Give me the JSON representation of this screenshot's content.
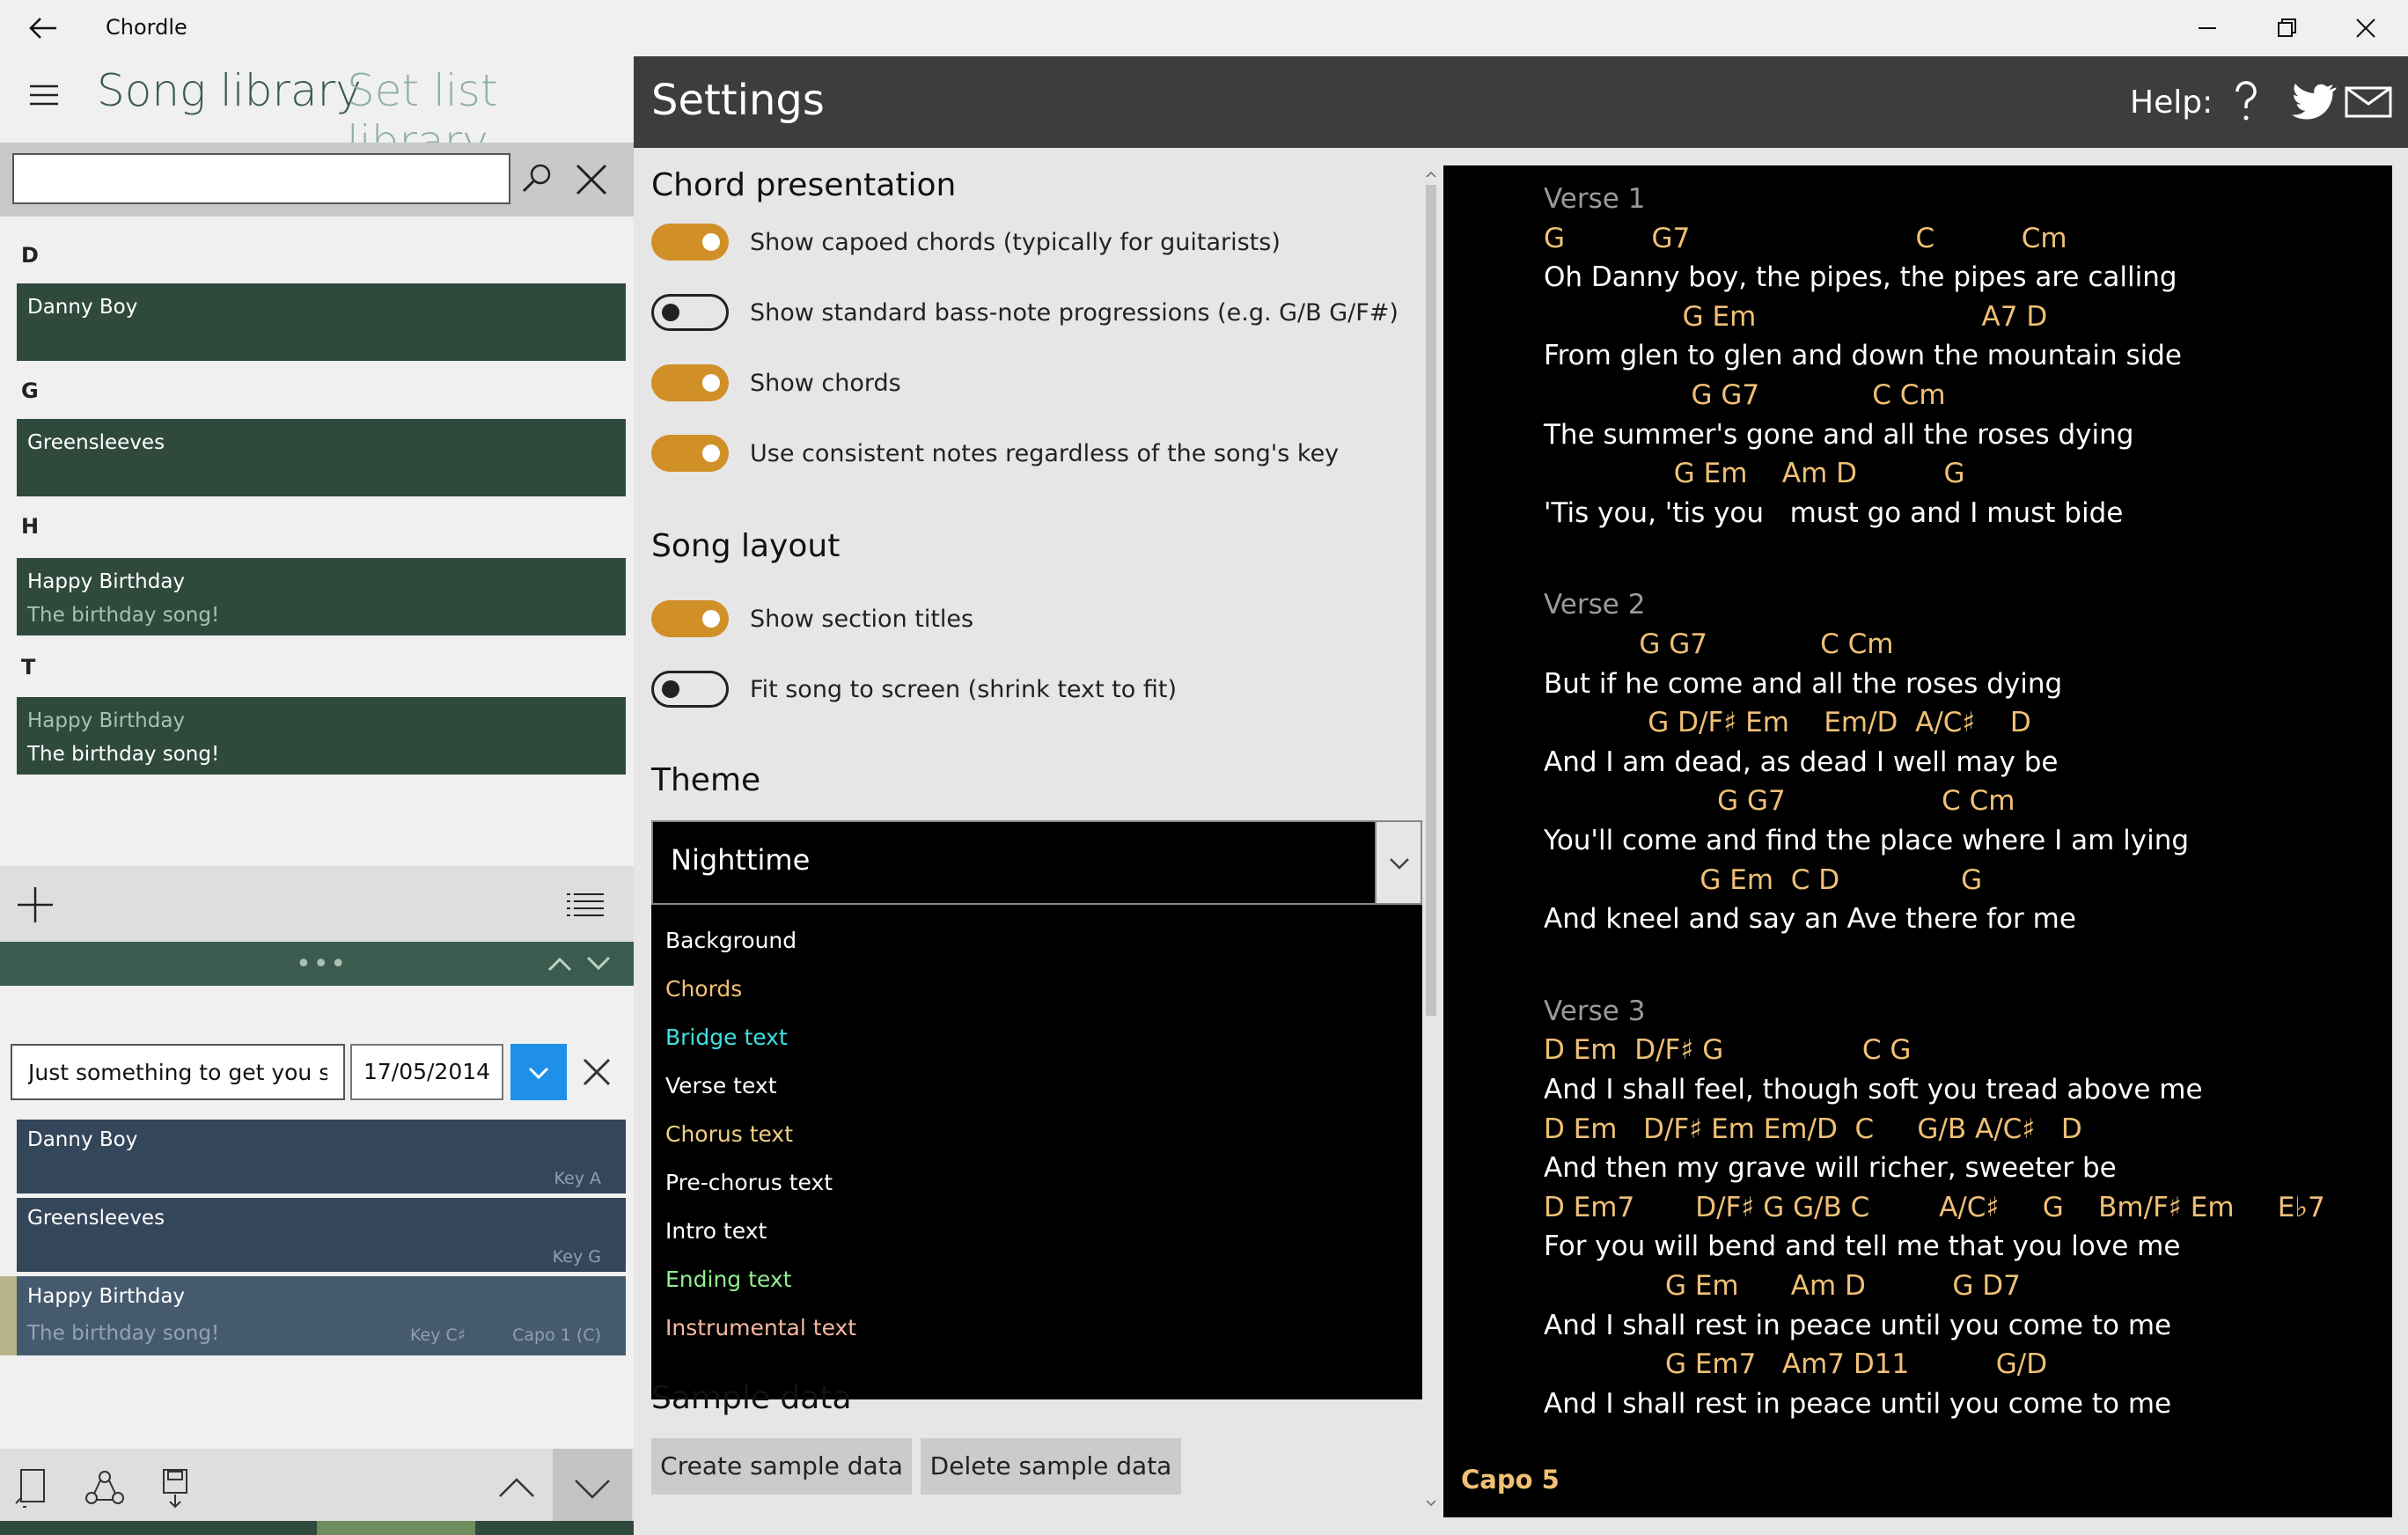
{
  "window": {
    "title": "Chordle"
  },
  "left": {
    "tabs": {
      "song_library": "Song library",
      "setlist_library": "Set list library"
    },
    "search": {
      "value": "",
      "placeholder": ""
    },
    "groups": [
      {
        "letter": "D",
        "songs": [
          {
            "title": "Danny Boy",
            "subtitle": ""
          }
        ]
      },
      {
        "letter": "G",
        "songs": [
          {
            "title": "Greensleeves",
            "subtitle": ""
          }
        ]
      },
      {
        "letter": "H",
        "songs": [
          {
            "title": "Happy Birthday",
            "subtitle": "The birthday song!"
          }
        ]
      },
      {
        "letter": "T",
        "songs": [
          {
            "title": "Happy Birthday",
            "subtitle": "The birthday song!"
          }
        ]
      }
    ],
    "splitter_dots": "•••",
    "setlist": {
      "name": "Just something to get you sta",
      "date": "17/05/2014",
      "items": [
        {
          "title": "Danny Boy",
          "subtitle": "",
          "key": "Key A",
          "capo": ""
        },
        {
          "title": "Greensleeves",
          "subtitle": "",
          "key": "Key G",
          "capo": ""
        },
        {
          "title": "Happy Birthday",
          "subtitle": "The birthday song!",
          "key": "Key C♯",
          "capo": "Capo 1 (C)"
        }
      ]
    }
  },
  "settings": {
    "title": "Settings",
    "help_label": "Help:",
    "chord_presentation": {
      "heading": "Chord presentation",
      "options": [
        {
          "label": "Show capoed chords (typically for guitarists)",
          "on": true
        },
        {
          "label": "Show standard bass-note progressions (e.g. G/B G/F#)",
          "on": false
        },
        {
          "label": "Show chords",
          "on": true
        },
        {
          "label": "Use consistent notes regardless of the song's key",
          "on": true
        }
      ]
    },
    "song_layout": {
      "heading": "Song layout",
      "options": [
        {
          "label": "Show section titles",
          "on": true
        },
        {
          "label": "Fit song to screen (shrink text to fit)",
          "on": false
        }
      ]
    },
    "theme": {
      "heading": "Theme",
      "selected": "Nighttime",
      "items": [
        {
          "label": "Background",
          "color": "#ffffff"
        },
        {
          "label": "Chords",
          "color": "#f0c075"
        },
        {
          "label": "Bridge text",
          "color": "#40e0e0"
        },
        {
          "label": "Verse text",
          "color": "#ffffff"
        },
        {
          "label": "Chorus text",
          "color": "#f0d080"
        },
        {
          "label": "Pre-chorus text",
          "color": "#ffffff"
        },
        {
          "label": "Intro text",
          "color": "#ffffff"
        },
        {
          "label": "Ending text",
          "color": "#90ee90"
        },
        {
          "label": "Instrumental text",
          "color": "#f5b8a0"
        }
      ]
    },
    "sample_data": {
      "heading": "Sample data",
      "create": "Create sample data",
      "delete": "Delete sample data"
    }
  },
  "preview": {
    "lines": [
      {
        "type": "title",
        "text": "Verse 1"
      },
      {
        "type": "chord",
        "text": "G          G7                          C          Cm"
      },
      {
        "type": "lyric",
        "text": "Oh Danny boy, the pipes, the pipes are calling"
      },
      {
        "type": "chord",
        "text": "                G Em                          A7 D"
      },
      {
        "type": "lyric",
        "text": "From glen to glen and down the mountain side"
      },
      {
        "type": "chord",
        "text": "                 G G7             C Cm"
      },
      {
        "type": "lyric",
        "text": "The summer's gone and all the roses dying"
      },
      {
        "type": "chord",
        "text": "               G Em    Am D          G"
      },
      {
        "type": "lyric",
        "text": "'Tis you, 'tis you   must go and I must bide"
      },
      {
        "type": "gap",
        "text": ""
      },
      {
        "type": "title",
        "text": "Verse 2"
      },
      {
        "type": "chord",
        "text": "           G G7             C Cm"
      },
      {
        "type": "lyric",
        "text": "But if he come and all the roses dying"
      },
      {
        "type": "chord",
        "text": "            G D/F♯ Em    Em/D  A/C♯    D"
      },
      {
        "type": "lyric",
        "text": "And I am dead, as dead I well may be"
      },
      {
        "type": "chord",
        "text": "                    G G7                  C Cm"
      },
      {
        "type": "lyric",
        "text": "You'll come and find the place where I am lying"
      },
      {
        "type": "chord",
        "text": "                  G Em  C D              G"
      },
      {
        "type": "lyric",
        "text": "And kneel and say an Ave there for me"
      },
      {
        "type": "gap",
        "text": ""
      },
      {
        "type": "title",
        "text": "Verse 3"
      },
      {
        "type": "chord",
        "text": "D Em  D/F♯ G                C G"
      },
      {
        "type": "lyric",
        "text": "And I shall feel, though soft you tread above me"
      },
      {
        "type": "chord",
        "text": "D Em   D/F♯ Em Em/D  C     G/B A/C♯   D"
      },
      {
        "type": "lyric",
        "text": "And then my grave will richer, sweeter be"
      },
      {
        "type": "chord",
        "text": "D Em7       D/F♯ G G/B C        A/C♯     G    Bm/F♯ Em     E♭7"
      },
      {
        "type": "lyric",
        "text": "For you will bend and tell me that you love me"
      },
      {
        "type": "chord",
        "text": "              G Em      Am D          G D7"
      },
      {
        "type": "lyric",
        "text": "And I shall rest in peace until you come to me"
      },
      {
        "type": "chord",
        "text": "              G Em7   Am7 D11          G/D"
      },
      {
        "type": "lyric",
        "text": "And I shall rest in peace until you come to me"
      }
    ],
    "capo": "Capo 5"
  }
}
